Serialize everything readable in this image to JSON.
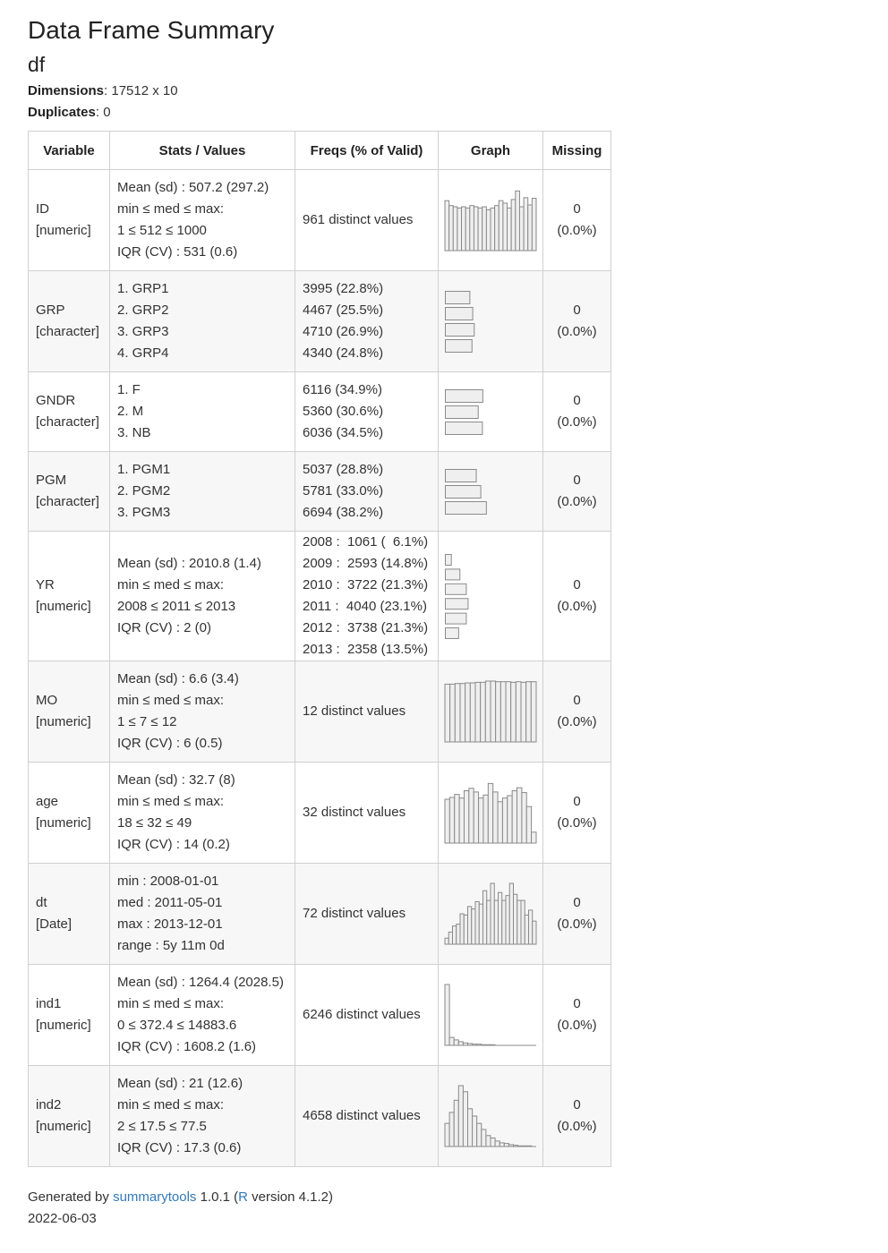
{
  "title": "Data Frame Summary",
  "subtitle": "df",
  "dimensions_label": "Dimensions",
  "dimensions_value": ": 17512 x 10",
  "duplicates_label": "Duplicates",
  "duplicates_value": ": 0",
  "headers": [
    "Variable",
    "Stats / Values",
    "Freqs (% of Valid)",
    "Graph",
    "Missing"
  ],
  "rows": [
    {
      "variable": [
        "ID",
        "[numeric]"
      ],
      "stats": [
        "Mean (sd) : 507.2 (297.2)",
        "min ≤ med ≤ max:",
        "1 ≤ 512 ≤ 1000",
        "IQR (CV) : 531 (0.6)"
      ],
      "freqs": [
        "961 distinct values"
      ],
      "missing": [
        "0",
        "(0.0%)"
      ]
    },
    {
      "variable": [
        "GRP",
        "[character]"
      ],
      "stats": [
        "1. GRP1",
        "2. GRP2",
        "3. GRP3",
        "4. GRP4"
      ],
      "freqs": [
        "3995 (22.8%)",
        "4467 (25.5%)",
        "4710 (26.9%)",
        "4340 (24.8%)"
      ],
      "missing": [
        "0",
        "(0.0%)"
      ]
    },
    {
      "variable": [
        "GNDR",
        "[character]"
      ],
      "stats": [
        "1. F",
        "2. M",
        "3. NB"
      ],
      "freqs": [
        "6116 (34.9%)",
        "5360 (30.6%)",
        "6036 (34.5%)"
      ],
      "missing": [
        "0",
        "(0.0%)"
      ]
    },
    {
      "variable": [
        "PGM",
        "[character]"
      ],
      "stats": [
        "1. PGM1",
        "2. PGM2",
        "3. PGM3"
      ],
      "freqs": [
        "5037 (28.8%)",
        "5781 (33.0%)",
        "6694 (38.2%)"
      ],
      "missing": [
        "0",
        "(0.0%)"
      ]
    },
    {
      "variable": [
        "YR",
        "[numeric]"
      ],
      "stats": [
        "Mean (sd) : 2010.8 (1.4)",
        "min ≤ med ≤ max:",
        "2008 ≤ 2011 ≤ 2013",
        "IQR (CV) : 2 (0)"
      ],
      "freqs": [
        "2008 :  1061 (  6.1%)",
        "2009 :  2593 (14.8%)",
        "2010 :  3722 (21.3%)",
        "2011 :  4040 (23.1%)",
        "2012 :  3738 (21.3%)",
        "2013 :  2358 (13.5%)"
      ],
      "missing": [
        "0",
        "(0.0%)"
      ]
    },
    {
      "variable": [
        "MO",
        "[numeric]"
      ],
      "stats": [
        "Mean (sd) : 6.6 (3.4)",
        "min ≤ med ≤ max:",
        "1 ≤ 7 ≤ 12",
        "IQR (CV) : 6 (0.5)"
      ],
      "freqs": [
        "12 distinct values"
      ],
      "missing": [
        "0",
        "(0.0%)"
      ]
    },
    {
      "variable": [
        "age",
        "[numeric]"
      ],
      "stats": [
        "Mean (sd) : 32.7 (8)",
        "min ≤ med ≤ max:",
        "18 ≤ 32 ≤ 49",
        "IQR (CV) : 14 (0.2)"
      ],
      "freqs": [
        "32 distinct values"
      ],
      "missing": [
        "0",
        "(0.0%)"
      ]
    },
    {
      "variable": [
        "dt",
        "[Date]"
      ],
      "stats": [
        "min : 2008-01-01",
        "med : 2011-05-01",
        "max : 2013-12-01",
        "range : 5y 11m 0d"
      ],
      "freqs": [
        "72 distinct values"
      ],
      "missing": [
        "0",
        "(0.0%)"
      ]
    },
    {
      "variable": [
        "ind1",
        "[numeric]"
      ],
      "stats": [
        "Mean (sd) : 1264.4 (2028.5)",
        "min ≤ med ≤ max:",
        "0 ≤ 372.4 ≤ 14883.6",
        "IQR (CV) : 1608.2 (1.6)"
      ],
      "freqs": [
        "6246 distinct values"
      ],
      "missing": [
        "0",
        "(0.0%)"
      ]
    },
    {
      "variable": [
        "ind2",
        "[numeric]"
      ],
      "stats": [
        "Mean (sd) : 21 (12.6)",
        "min ≤ med ≤ max:",
        "2 ≤ 17.5 ≤ 77.5",
        "IQR (CV) : 17.3 (0.6)"
      ],
      "freqs": [
        "4658 distinct values"
      ],
      "missing": [
        "0",
        "(0.0%)"
      ]
    }
  ],
  "chart_data": [
    {
      "type": "bar",
      "variable": "ID",
      "values": [
        0.82,
        0.74,
        0.72,
        0.7,
        0.72,
        0.7,
        0.74,
        0.72,
        0.7,
        0.72,
        0.67,
        0.7,
        0.74,
        0.82,
        0.78,
        0.7,
        0.84,
        0.98,
        0.72,
        0.87,
        0.75,
        0.86
      ]
    },
    {
      "type": "bar",
      "orientation": "horizontal",
      "variable": "GRP",
      "values": [
        0.228,
        0.255,
        0.269,
        0.248
      ]
    },
    {
      "type": "bar",
      "orientation": "horizontal",
      "variable": "GNDR",
      "values": [
        0.349,
        0.306,
        0.345
      ]
    },
    {
      "type": "bar",
      "orientation": "horizontal",
      "variable": "PGM",
      "values": [
        0.288,
        0.33,
        0.382
      ]
    },
    {
      "type": "bar",
      "orientation": "horizontal",
      "variable": "YR",
      "values": [
        0.061,
        0.148,
        0.213,
        0.231,
        0.213,
        0.135
      ]
    },
    {
      "type": "bar",
      "variable": "MO",
      "values": [
        0.95,
        0.95,
        0.96,
        0.96,
        0.97,
        0.97,
        0.98,
        0.98,
        1.0,
        1.0,
        0.99,
        0.99,
        0.99,
        0.98,
        0.99,
        0.98,
        0.99,
        0.99
      ]
    },
    {
      "type": "bar",
      "variable": "age",
      "values": [
        0.72,
        0.75,
        0.8,
        0.74,
        0.86,
        0.9,
        0.84,
        0.74,
        0.79,
        0.98,
        0.84,
        0.68,
        0.74,
        0.78,
        0.86,
        0.91,
        0.83,
        0.6,
        0.18
      ]
    },
    {
      "type": "bar",
      "variable": "dt",
      "values": [
        0.1,
        0.2,
        0.3,
        0.33,
        0.5,
        0.48,
        0.62,
        0.58,
        0.7,
        0.66,
        0.88,
        0.72,
        1.0,
        0.72,
        0.85,
        0.72,
        0.8,
        1.0,
        0.82,
        0.72,
        0.72,
        0.48,
        0.56,
        0.38
      ]
    },
    {
      "type": "bar",
      "variable": "ind1",
      "values": [
        1.0,
        0.13,
        0.09,
        0.06,
        0.04,
        0.03,
        0.02,
        0.02,
        0.01,
        0.01,
        0.01,
        0.0,
        0.0,
        0.0,
        0.0,
        0.0,
        0.0,
        0.0,
        0.0,
        0.0
      ]
    },
    {
      "type": "bar",
      "variable": "ind2",
      "values": [
        0.38,
        0.56,
        0.76,
        1.0,
        0.9,
        0.62,
        0.5,
        0.38,
        0.28,
        0.18,
        0.14,
        0.09,
        0.06,
        0.05,
        0.03,
        0.02,
        0.01,
        0.01,
        0.01,
        0.0
      ]
    }
  ],
  "footer": {
    "generated_by": "Generated by ",
    "pkg_link": "summarytools",
    "pkg_version": " 1.0.1 (",
    "r_link": "R",
    "r_version": " version 4.1.2)",
    "date": "2022-06-03"
  }
}
